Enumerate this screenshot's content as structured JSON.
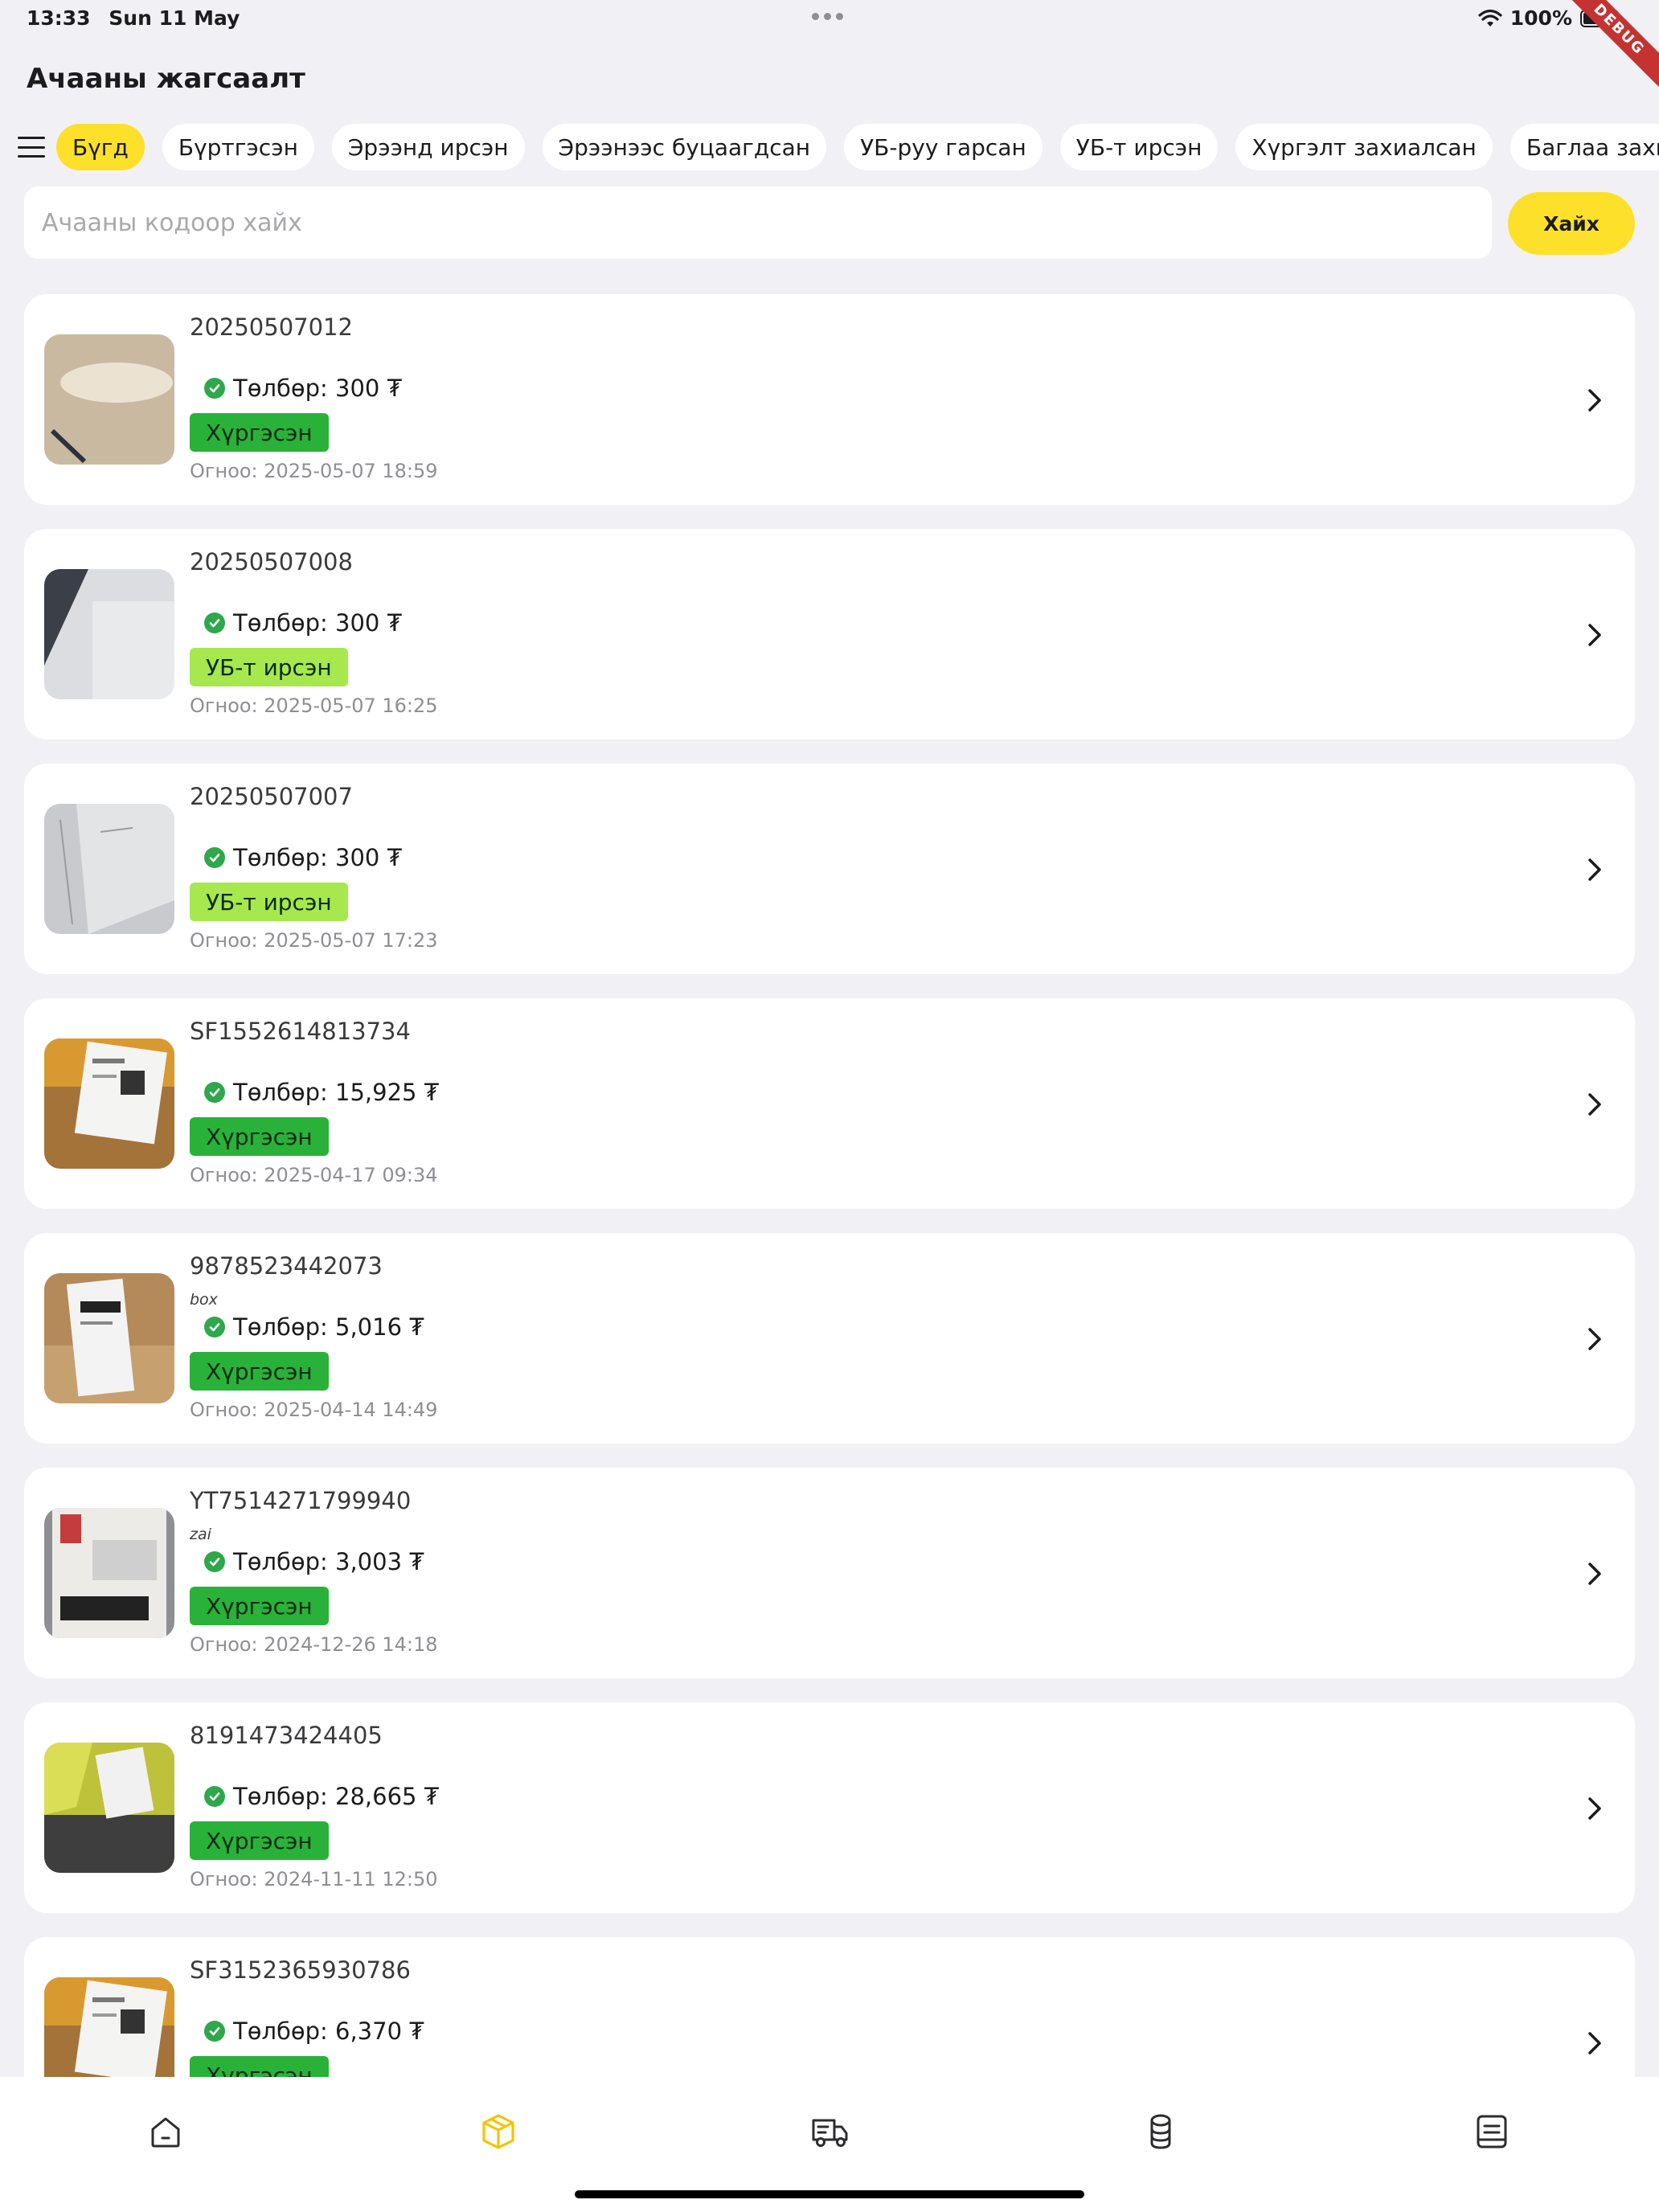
{
  "status_bar": {
    "time": "13:33",
    "date": "Sun 11 May",
    "battery": "100%",
    "debug_label": "DEBUG"
  },
  "page_title": "Ачааны жагсаалт",
  "filters": [
    {
      "label": "Бүгд",
      "active": true
    },
    {
      "label": "Бүртгэсэн",
      "active": false
    },
    {
      "label": "Эрээнд ирсэн",
      "active": false
    },
    {
      "label": "Эрээнээс буцаагдсан",
      "active": false
    },
    {
      "label": "УБ-руу гарсан",
      "active": false
    },
    {
      "label": "УБ-т ирсэн",
      "active": false
    },
    {
      "label": "Хүргэлт захиалсан",
      "active": false
    },
    {
      "label": "Баглаа захиалсан",
      "active": false
    }
  ],
  "search": {
    "placeholder": "Ачааны кодоор хайх",
    "value": "",
    "button_label": "Хайх"
  },
  "colors": {
    "accent": "#fde02a",
    "status_delivered": "#2ab13a",
    "status_arrived_ub": "#a6e84d",
    "check": "#2ea84a"
  },
  "shipments": [
    {
      "code": "20250507012",
      "note": "",
      "payment": "Төлбөр: 300 ₮",
      "status": "Хүргэсэн",
      "status_type": "green",
      "date": "Огноо: 2025-05-07 18:59",
      "thumb": "wood-table-photo"
    },
    {
      "code": "20250507008",
      "note": "",
      "payment": "Төлбөр: 300 ₮",
      "status": "УБ-т ирсэн",
      "status_type": "lime",
      "date": "Огноо: 2025-05-07 16:25",
      "thumb": "white-surface-photo"
    },
    {
      "code": "20250507007",
      "note": "",
      "payment": "Төлбөр: 300 ₮",
      "status": "УБ-т ирсэн",
      "status_type": "lime",
      "date": "Огноо: 2025-05-07 17:23",
      "thumb": "whiteboard-photo"
    },
    {
      "code": "SF1552614813734",
      "note": "",
      "payment": "Төлбөр: 15,925 ₮",
      "status": "Хүргэсэн",
      "status_type": "green",
      "date": "Огноо: 2025-04-17 09:34",
      "thumb": "parcel-label-photo"
    },
    {
      "code": "9878523442073",
      "note": "box",
      "payment": "Төлбөр: 5,016 ₮",
      "status": "Хүргэсэн",
      "status_type": "green",
      "date": "Огноо: 2025-04-14 14:49",
      "thumb": "box-label-photo"
    },
    {
      "code": "YT7514271799940",
      "note": "zai",
      "payment": "Төлбөр: 3,003 ₮",
      "status": "Хүргэсэн",
      "status_type": "green",
      "date": "Огноо: 2024-12-26 14:18",
      "thumb": "barcode-photo"
    },
    {
      "code": "8191473424405",
      "note": "",
      "payment": "Төлбөр: 28,665 ₮",
      "status": "Хүргэсэн",
      "status_type": "green",
      "date": "Огноо: 2024-11-11 12:50",
      "thumb": "yellow-bag-photo"
    },
    {
      "code": "SF3152365930786",
      "note": "",
      "payment": "Төлбөр: 6,370 ₮",
      "status": "Хүргэсэн",
      "status_type": "green",
      "date": "",
      "thumb": "parcel-label-photo"
    }
  ],
  "tabs": [
    {
      "icon": "home-icon",
      "active": false
    },
    {
      "icon": "package-icon",
      "active": true
    },
    {
      "icon": "truck-icon",
      "active": false
    },
    {
      "icon": "coins-icon",
      "active": false
    },
    {
      "icon": "document-icon",
      "active": false
    }
  ]
}
